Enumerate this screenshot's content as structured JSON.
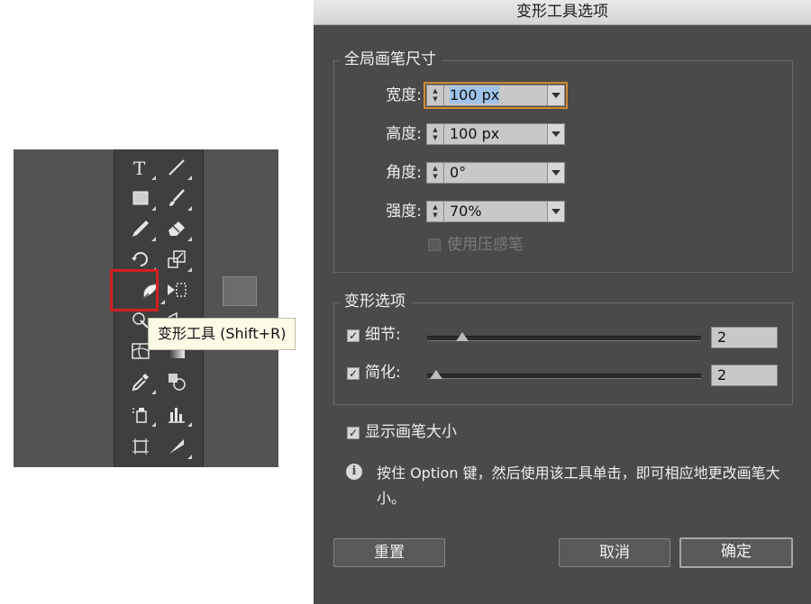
{
  "toolbar": {
    "tooltip": "变形工具 (Shift+R)",
    "tools": [
      {
        "name": "type-icon"
      },
      {
        "name": "line-segment-icon"
      },
      {
        "name": "rectangle-icon"
      },
      {
        "name": "paintbrush-icon"
      },
      {
        "name": "pencil-icon"
      },
      {
        "name": "eraser-icon"
      },
      {
        "name": "rotate-icon"
      },
      {
        "name": "scale-icon"
      },
      {
        "name": "warp-icon"
      },
      {
        "name": "free-transform-icon"
      },
      {
        "name": "shape-builder-icon"
      },
      {
        "name": "perspective-grid-icon"
      },
      {
        "name": "mesh-icon"
      },
      {
        "name": "gradient-icon"
      },
      {
        "name": "eyedropper-icon"
      },
      {
        "name": "blend-icon"
      },
      {
        "name": "symbol-sprayer-icon"
      },
      {
        "name": "column-graph-icon"
      },
      {
        "name": "artboard-icon"
      },
      {
        "name": "slice-icon"
      }
    ],
    "highlight_color": "#d21f1f"
  },
  "dialog": {
    "title": "变形工具选项",
    "global_brush": {
      "title": "全局画笔尺寸",
      "width_label": "宽度:",
      "width_value": "100 px",
      "height_label": "高度:",
      "height_value": "100 px",
      "angle_label": "角度:",
      "angle_value": "0°",
      "intensity_label": "强度:",
      "intensity_value": "70%",
      "pressure_label": "使用压感笔",
      "pressure_checked": false
    },
    "warp_options": {
      "title": "变形选项",
      "detail_label": "细节:",
      "detail_value": "2",
      "detail_checked": true,
      "simplify_label": "简化:",
      "simplify_value": "2",
      "simplify_checked": true
    },
    "show_brush_size_label": "显示画笔大小",
    "show_brush_size_checked": true,
    "info_text": "按住 Option 键，然后使用该工具单击，即可相应地更改画笔大小。",
    "buttons": {
      "reset": "重置",
      "cancel": "取消",
      "ok": "确定"
    },
    "focus_color": "#d08a2e"
  }
}
